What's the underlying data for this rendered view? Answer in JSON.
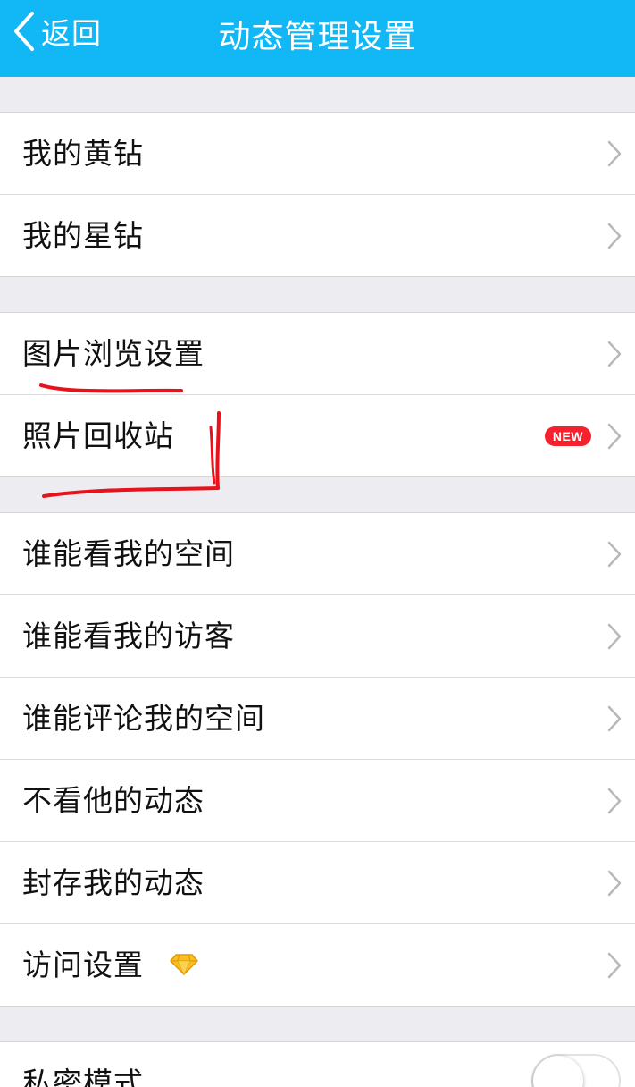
{
  "nav": {
    "back_label": "返回",
    "title": "动态管理设置",
    "bg_color": "#12b7f5"
  },
  "groups": [
    {
      "items": [
        {
          "label": "我的黄钻"
        },
        {
          "label": "我的星钻"
        }
      ]
    },
    {
      "items": [
        {
          "label": "图片浏览设置"
        },
        {
          "label": "照片回收站",
          "badge": "NEW"
        }
      ]
    },
    {
      "items": [
        {
          "label": "谁能看我的空间"
        },
        {
          "label": "谁能看我的访客"
        },
        {
          "label": "谁能评论我的空间"
        },
        {
          "label": "不看他的动态"
        },
        {
          "label": "封存我的动态"
        },
        {
          "label": "访问设置",
          "icon": "diamond-icon"
        }
      ]
    },
    {
      "items": [
        {
          "label": "私密模式",
          "toggle": false
        }
      ]
    }
  ],
  "colors": {
    "badge": "#f5222d",
    "annotation": "#e8121b"
  }
}
